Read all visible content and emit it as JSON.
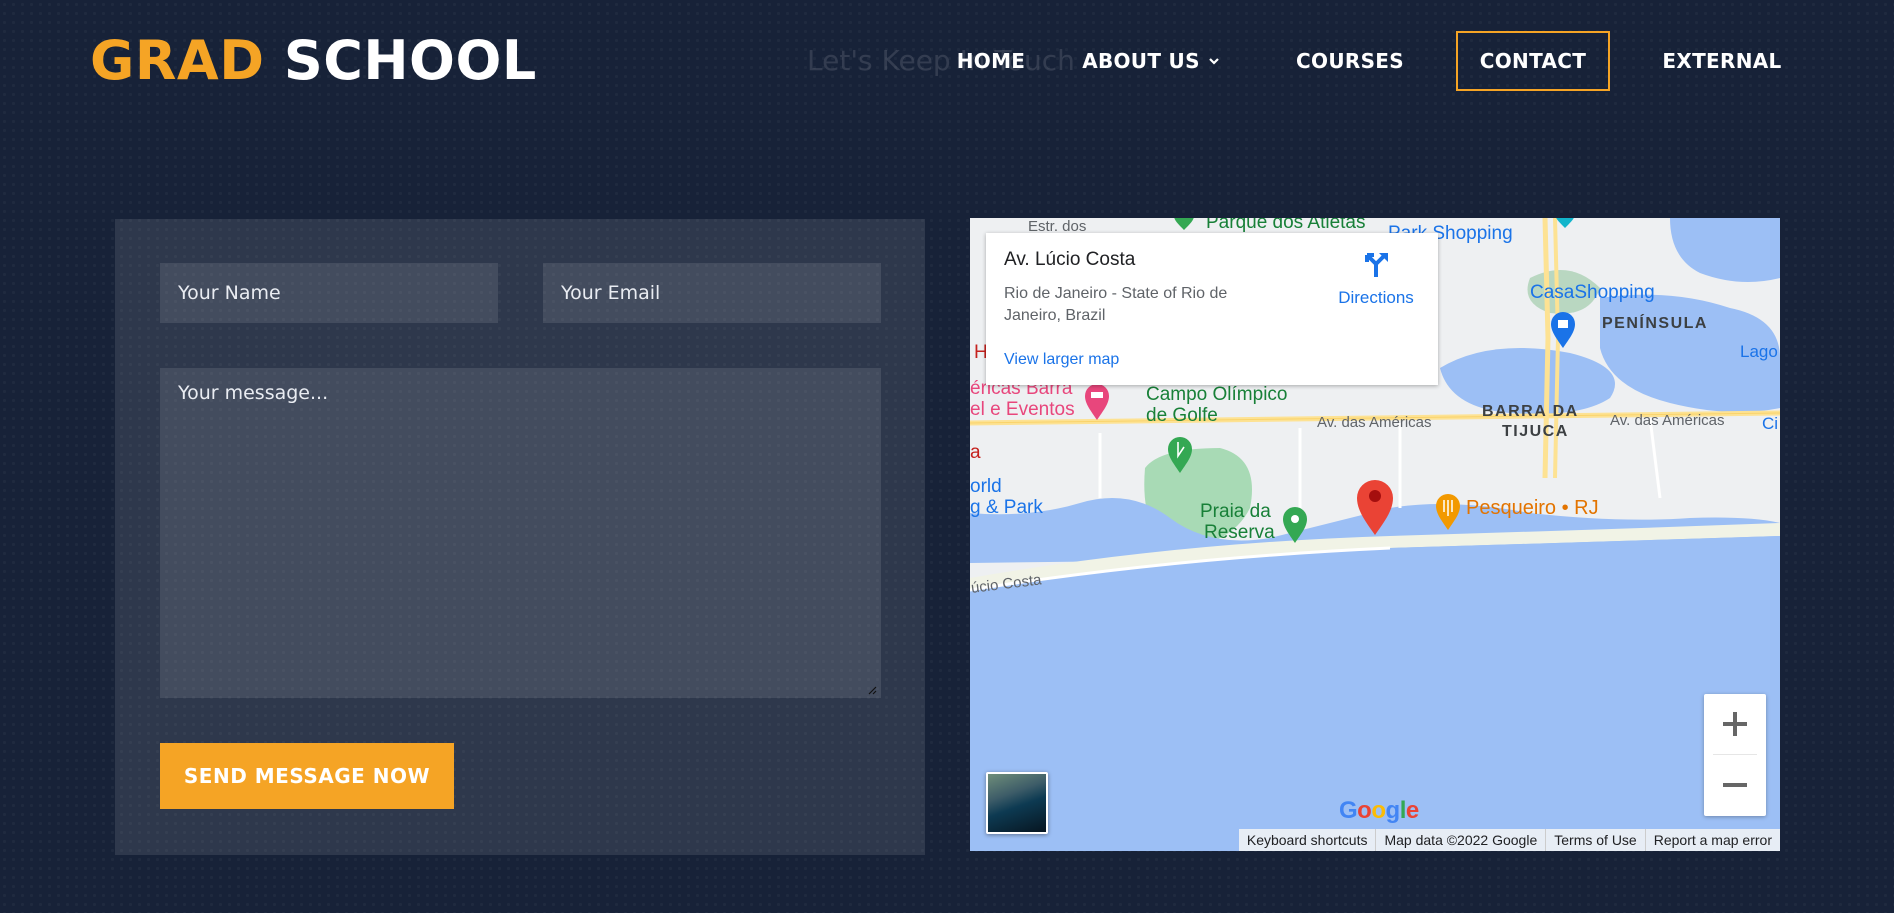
{
  "brand": {
    "first": "GRAD",
    "second": "SCHOOL"
  },
  "section_heading": "Let's Keep In Touch",
  "nav": {
    "home": "HOME",
    "about": "ABOUT US",
    "courses": "COURSES",
    "contact": "CONTACT",
    "external": "EXTERNAL"
  },
  "form": {
    "name_placeholder": "Your Name",
    "email_placeholder": "Your Email",
    "message_placeholder": "Your message...",
    "submit_label": "SEND MESSAGE NOW"
  },
  "map": {
    "place_title": "Av. Lúcio Costa",
    "place_address": "Rio de Janeiro - State of Rio de Janeiro, Brazil",
    "directions_label": "Directions",
    "larger_map_label": "View larger map",
    "labels": {
      "parque": "Parque dos Atletas",
      "park_shopping": "Park Shopping",
      "casashopping": "CasaShopping",
      "peninsula": "PENÍNSULA",
      "lagoa": "Lago",
      "campo_line1": "Campo Olímpico",
      "campo_line2": "de Golfe",
      "americas_line1": "éricas Barra",
      "americas_line2": "el e Eventos",
      "av_americas_1": "Av. das Américas",
      "av_americas_2": "Av. das Américas",
      "barra_line1": "BARRA DA",
      "barra_line2": "TIJUCA",
      "world_line1": "orld",
      "world_line2": "g & Park",
      "praia_line1": "Praia da",
      "praia_line2": "Reserva",
      "pesqueiro": "Pesqueiro • RJ",
      "lucio_road": "úcio Costa",
      "ci": "Ci",
      "h": "H",
      "a": "a",
      "estr": "Estr. dos"
    },
    "google": "Google",
    "attribution": {
      "keyboard": "Keyboard shortcuts",
      "data": "Map data ©2022 Google",
      "terms": "Terms of Use",
      "report": "Report a map error"
    }
  },
  "colors": {
    "accent": "#f5a425",
    "background": "#172238",
    "water": "#9cbff5",
    "park": "#a8dab5"
  },
  "icons": [
    "chevron-down-icon",
    "directions-icon",
    "map-pin-icon",
    "zoom-in-icon",
    "zoom-out-icon",
    "golf-icon",
    "beach-icon",
    "restaurant-icon",
    "shopping-icon",
    "hotel-icon"
  ]
}
